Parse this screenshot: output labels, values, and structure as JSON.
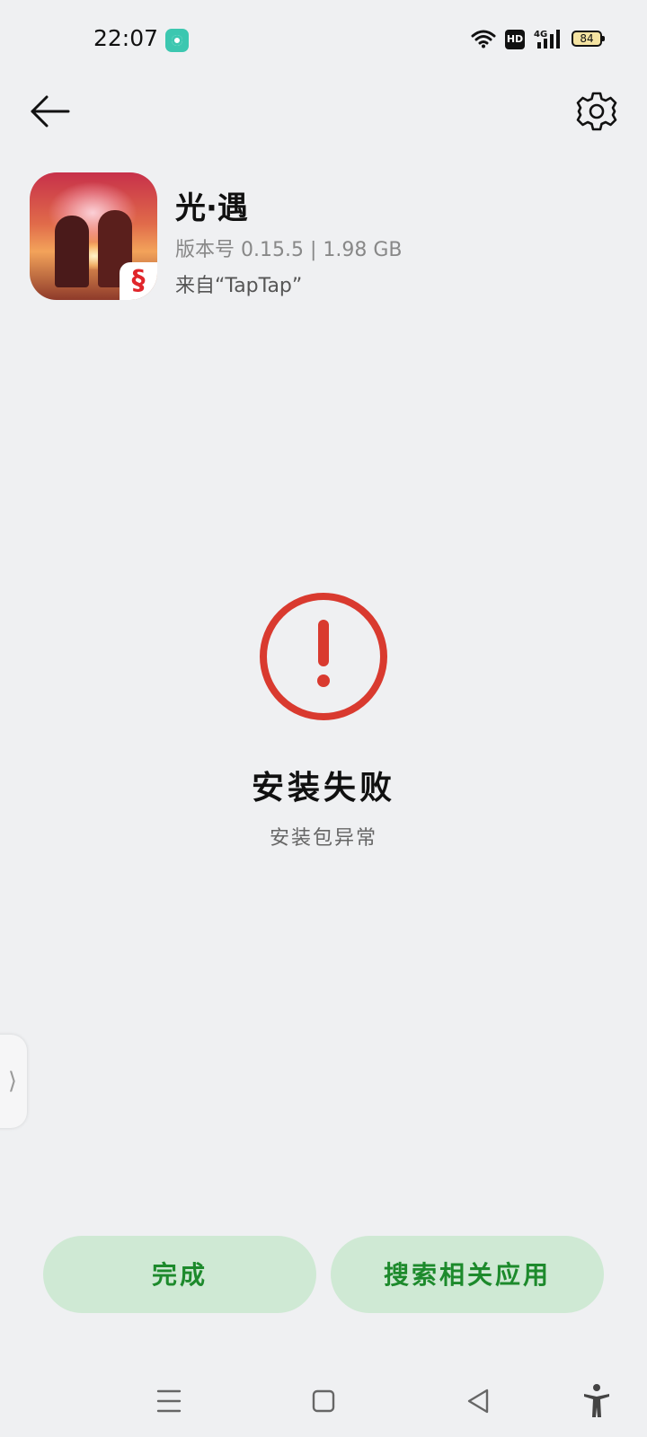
{
  "status_bar": {
    "time": "22:07",
    "network": "4G",
    "hd": "HD",
    "battery": "84"
  },
  "icons": {
    "back": "arrow-left-icon",
    "settings": "gear-icon",
    "error": "exclamation-circle-icon",
    "app_badge": "netease-logo-icon"
  },
  "app": {
    "name": "光·遇",
    "version_line": "版本号 0.15.5 | 1.98 GB",
    "source": "来自“TapTap”"
  },
  "result": {
    "title": "安装失败",
    "subtitle": "安装包异常"
  },
  "side_handle": {
    "glyph": "⟩"
  },
  "actions": {
    "done_label": "完成",
    "search_label": "搜索相关应用"
  },
  "colors": {
    "accent_green": "#1d8a2c",
    "button_bg": "#cfe9d4",
    "error_red": "#d93a2f",
    "background": "#eff0f2"
  }
}
